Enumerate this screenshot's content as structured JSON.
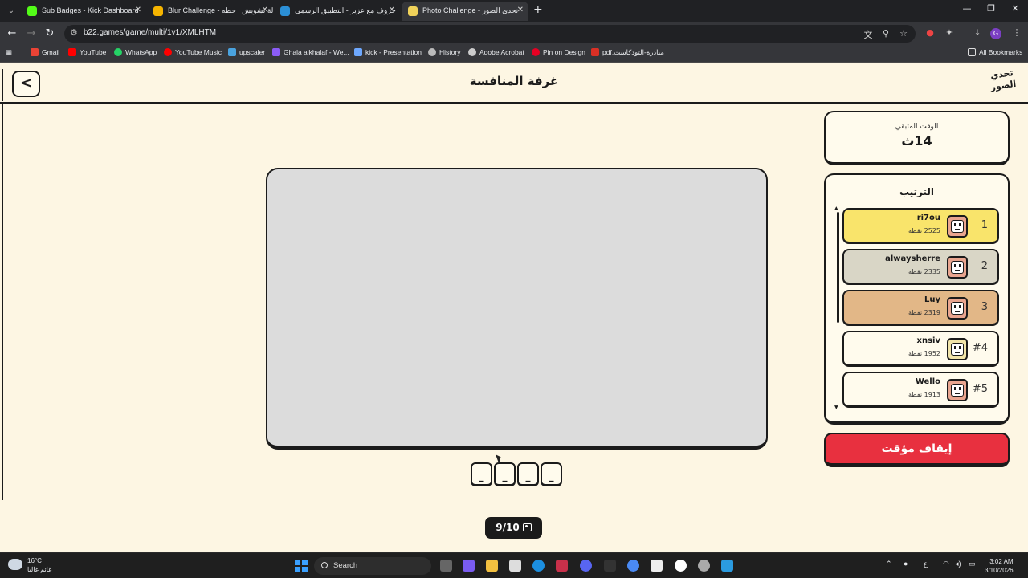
{
  "browser": {
    "tabs": [
      {
        "title": "Sub Badges - Kick Dashboard",
        "favicon_color": "#53fc18"
      },
      {
        "title": "Blur Challenge - جولة تشويش | حطه",
        "favicon_color": "#f5b400"
      },
      {
        "title": "حروف مع عزيز - التطبيق الرسمي",
        "favicon_color": "#2b8fd6"
      },
      {
        "title": "Photo Challenge - تحدي الصور",
        "favicon_color": "#f0d25a"
      }
    ],
    "active_tab_index": 3,
    "url": "b22.games/game/multi/1v1/XMLHTM",
    "bookmarks": [
      {
        "label": "Gmail",
        "color": "#ea4335"
      },
      {
        "label": "YouTube",
        "color": "#ff0000"
      },
      {
        "label": "WhatsApp",
        "color": "#25d366"
      },
      {
        "label": "YouTube Music",
        "color": "#ff0000"
      },
      {
        "label": "upscaler",
        "color": "#4aa3df"
      },
      {
        "label": "Ghala alkhalaf - We...",
        "color": "#8b5cf6"
      },
      {
        "label": "kick - Presentation",
        "color": "#6ea8fe"
      },
      {
        "label": "History",
        "color": "#bbbbbb"
      },
      {
        "label": "Adobe Acrobat",
        "color": "#cccccc"
      },
      {
        "label": "Pin on Design",
        "color": "#e60023"
      },
      {
        "label": "pdf.مبادرة-التودكاست",
        "color": "#d93025"
      }
    ],
    "all_bookmarks": "All Bookmarks"
  },
  "app": {
    "title": "غرفة المنافسة",
    "logo_text": "تحدي الصور",
    "timer": {
      "label": "الوقت المتبقي",
      "value": "14ث"
    },
    "ranking": {
      "title": "الترتيب",
      "players": [
        {
          "position": "1",
          "name": "ri7ou",
          "score": "2525 نقطة",
          "color": "#f9e46b",
          "avatar": "orange"
        },
        {
          "position": "2",
          "name": "alwaysherre",
          "score": "2335 نقطة",
          "color": "#d9d6c6",
          "avatar": "orange"
        },
        {
          "position": "3",
          "name": "Luy",
          "score": "2319 نقطة",
          "color": "#e2b787",
          "avatar": "orange"
        },
        {
          "position": "#4",
          "name": "xnsiv",
          "score": "1952 نقطة",
          "color": "#fffbed",
          "avatar": "pale"
        },
        {
          "position": "#5",
          "name": "Wello",
          "score": "1913 نقطة",
          "color": "#fffbed",
          "avatar": "orange"
        }
      ]
    },
    "pause_label": "إيقاف مؤقت",
    "answer_slots": [
      "_",
      "_",
      "_",
      "_"
    ],
    "progress": "9/10"
  },
  "taskbar": {
    "weather_temp": "16°C",
    "weather_desc": "غائم غالبا",
    "search_placeholder": "Search",
    "time": "3:02 AM",
    "date": "3/10/2026"
  }
}
